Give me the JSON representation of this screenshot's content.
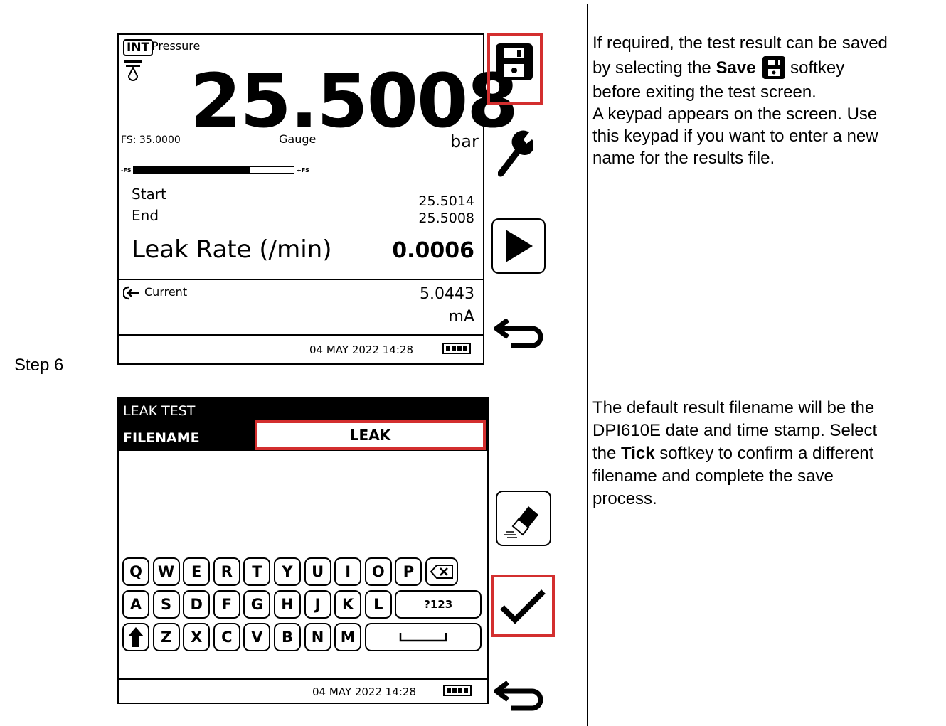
{
  "step_label": "Step 6",
  "screen1": {
    "int_badge": "INT",
    "mode": "Pressure",
    "reading": "25.5008",
    "fs": "FS: 35.0000",
    "gauge": "Gauge",
    "unit": "bar",
    "bar_min": "-FS",
    "bar_max": "+FS",
    "bar_fill": 0.73,
    "start_label": "Start",
    "start_value": "25.5014",
    "end_label": "End",
    "end_value": "25.5008",
    "leak_label": "Leak Rate (/min)",
    "leak_value": "0.0006",
    "current_label": "Current",
    "current_value": "5.0443",
    "current_unit": "mA",
    "status": "04 MAY 2022 14:28"
  },
  "screen2": {
    "header": "LEAK TEST",
    "filename_label": "FILENAME",
    "filename_value": "LEAK",
    "status": "04 MAY 2022 14:28",
    "row1": [
      "Q",
      "W",
      "E",
      "R",
      "T",
      "Y",
      "U",
      "I",
      "O",
      "P"
    ],
    "row2": [
      "A",
      "S",
      "D",
      "F",
      "G",
      "H",
      "J",
      "K",
      "L"
    ],
    "row3": [
      "Z",
      "X",
      "C",
      "V",
      "B",
      "N",
      "M"
    ],
    "numkey": "?123"
  },
  "desc1": {
    "line1": "If required, the test result can be saved",
    "line2a": "by selecting the ",
    "line2b": "Save",
    "line2c": " softkey",
    "line3": "before exiting the test screen.",
    "line4": "A keypad appears on the screen. Use",
    "line5": "this keypad if you want to enter a new",
    "line6": "name for the results file."
  },
  "desc2": {
    "line1": "The default result filename will be the",
    "line2": "DPI610E date and time stamp. Select",
    "line3a": "the ",
    "line3b": "Tick",
    "line3c": " softkey to confirm a different",
    "line4": "filename and complete the save",
    "line5": "process."
  },
  "colors": {
    "highlight": "#d32f2f"
  }
}
